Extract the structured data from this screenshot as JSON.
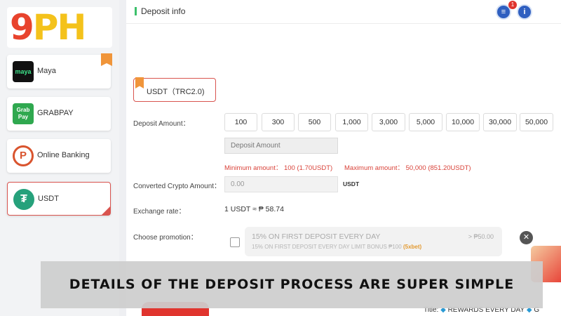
{
  "sidebar": {
    "logo_nine": "9",
    "logo_ph": "PH",
    "items": [
      {
        "label": "Maya",
        "icon": "maya-icon",
        "icon_text": "maya"
      },
      {
        "label": "GRABPAY",
        "icon": "grabpay-icon",
        "icon_text_1": "Grab",
        "icon_text_2": "Pay"
      },
      {
        "label": "Online Banking",
        "icon": "online-banking-icon"
      },
      {
        "label": "USDT",
        "icon": "usdt-icon",
        "icon_text": "₮",
        "active": true
      }
    ]
  },
  "header": {
    "title": "Deposit info",
    "notification_count": "1",
    "help_icon_text": "i",
    "notice_icon_text": "≡"
  },
  "form": {
    "currency": "USDT（TRC2.0)",
    "deposit_amount_label": "Deposit Amount：",
    "amounts": [
      "100",
      "300",
      "500",
      "1,000",
      "3,000",
      "5,000",
      "10,000",
      "30,000",
      "50,000"
    ],
    "amount_placeholder": "Deposit Amount",
    "minimum": "Minimum amount： 100 (1.70USDT)",
    "maximum": "Maximum amount： 50,000 (851.20USDT)",
    "converted_label": "Converted Crypto Amount：",
    "converted_value": "0.00",
    "converted_unit": "USDT",
    "exchange_label": "Exchange rate：",
    "exchange_value": "1 USDT ≈ ₱ 58.74",
    "promotion_label": "Choose promotion：",
    "promotion": {
      "title": "15% ON FIRST DEPOSIT EVERY DAY",
      "amount": "> ₱50.00",
      "subtitle": "15% ON FIRST DEPOSIT EVERY DAY LIMIT BONUS ₱100",
      "bet": "(5xbet)"
    },
    "close_symbol": "✕"
  },
  "ticker": {
    "prefix": "Title: ",
    "text": "REWARDS EVERY DAY",
    "suffix": "G"
  },
  "caption": "DETAILS OF THE DEPOSIT PROCESS ARE SUPER SIMPLE"
}
